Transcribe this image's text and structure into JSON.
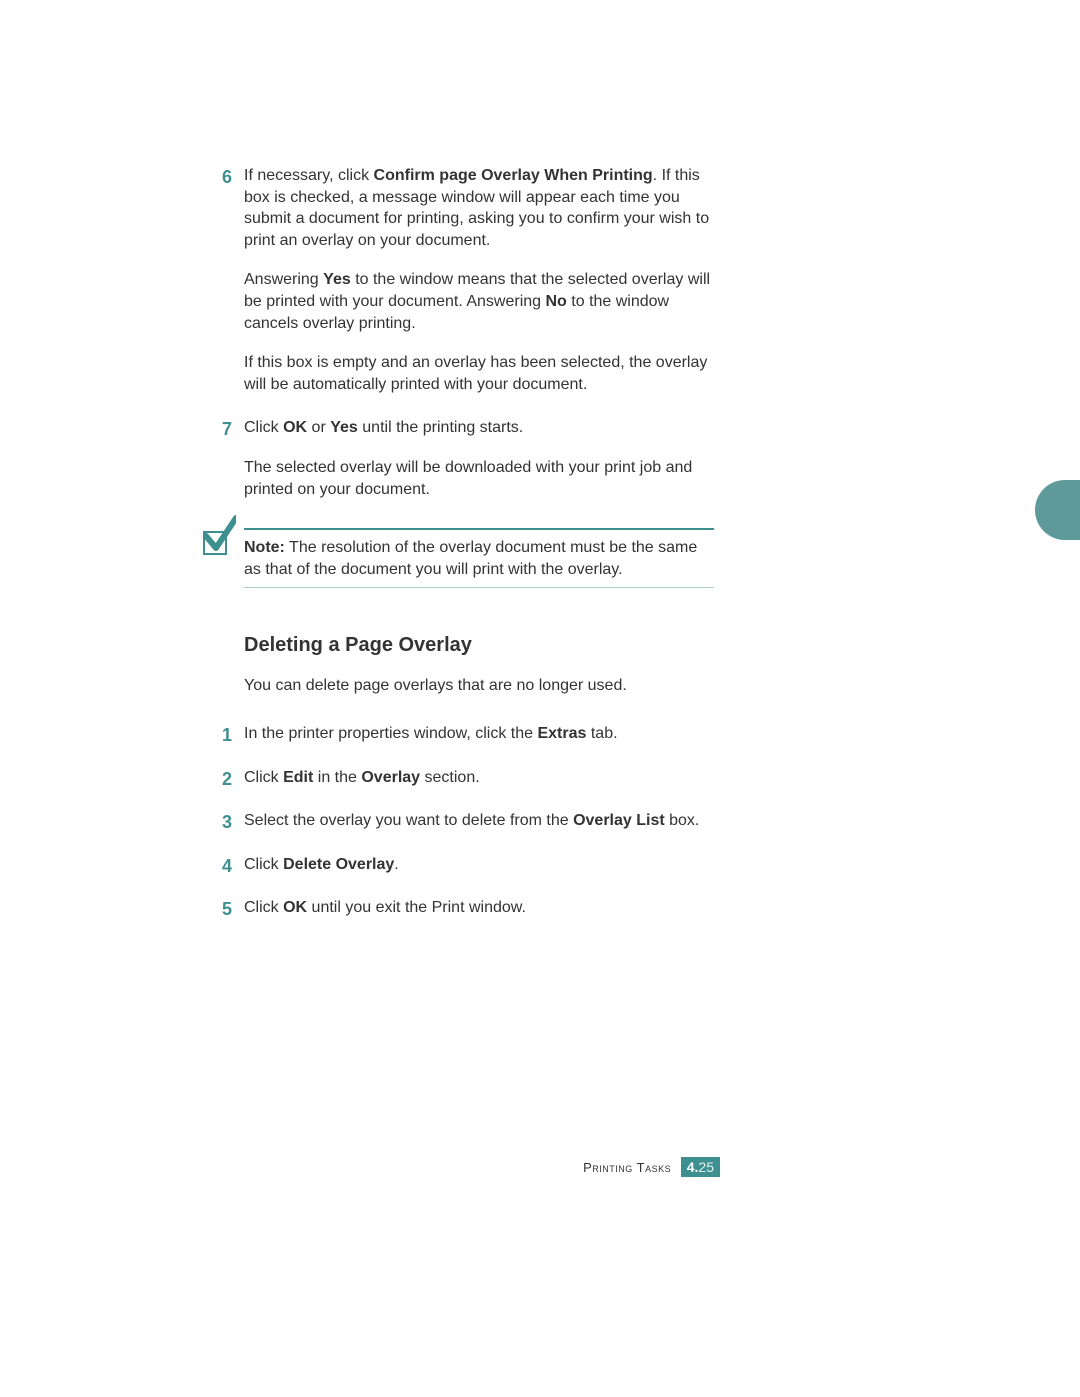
{
  "steps_a": [
    {
      "num": "6",
      "paras": [
        [
          {
            "t": "If necessary, click "
          },
          {
            "t": "Confirm page Overlay When Printing",
            "b": true
          },
          {
            "t": ". If this box is checked, a message window will appear each time you submit a document for printing, asking you to confirm your wish to print an overlay on your document."
          }
        ],
        [
          {
            "t": "Answering "
          },
          {
            "t": "Yes",
            "b": true
          },
          {
            "t": " to the window means that the selected overlay will be printed with your document. Answering "
          },
          {
            "t": "No",
            "b": true
          },
          {
            "t": " to the window cancels overlay printing."
          }
        ],
        [
          {
            "t": "If this box is empty and an overlay has been selected, the overlay will be automatically printed with your document."
          }
        ]
      ]
    },
    {
      "num": "7",
      "paras": [
        [
          {
            "t": "Click "
          },
          {
            "t": "OK",
            "b": true
          },
          {
            "t": " or "
          },
          {
            "t": "Yes",
            "b": true
          },
          {
            "t": " until the printing starts."
          }
        ],
        [
          {
            "t": "The selected overlay will be downloaded with your print job and printed on your document."
          }
        ]
      ]
    }
  ],
  "note": [
    {
      "t": "Note:",
      "b": true
    },
    {
      "t": " The resolution of the overlay document must be the same as that of the document you will print with the overlay."
    }
  ],
  "heading": "Deleting a Page Overlay",
  "intro": "You can delete page overlays that are no longer used.",
  "steps_b": [
    {
      "num": "1",
      "paras": [
        [
          {
            "t": "In the printer properties window, click the "
          },
          {
            "t": "Extras",
            "b": true
          },
          {
            "t": " tab."
          }
        ]
      ]
    },
    {
      "num": "2",
      "paras": [
        [
          {
            "t": "Click "
          },
          {
            "t": "Edit",
            "b": true
          },
          {
            "t": " in the "
          },
          {
            "t": "Overlay",
            "b": true
          },
          {
            "t": " section."
          }
        ]
      ]
    },
    {
      "num": "3",
      "paras": [
        [
          {
            "t": "Select the overlay you want to delete from the "
          },
          {
            "t": "Overlay List",
            "b": true
          },
          {
            "t": " box."
          }
        ]
      ]
    },
    {
      "num": "4",
      "paras": [
        [
          {
            "t": "Click "
          },
          {
            "t": "Delete Overlay",
            "b": true
          },
          {
            "t": "."
          }
        ]
      ]
    },
    {
      "num": "5",
      "paras": [
        [
          {
            "t": "Click "
          },
          {
            "t": "OK",
            "b": true
          },
          {
            "t": " until you exit the Print window."
          }
        ]
      ]
    }
  ],
  "footer": {
    "section": "Printing Tasks",
    "chapter": "4.",
    "page": "25"
  }
}
